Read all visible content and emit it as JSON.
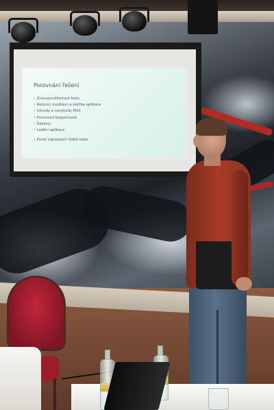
{
  "slide": {
    "title": "Porovnání řešení",
    "bullets": [
      "Znovupoužitelnost kódu",
      "Rodoucí rozdělení a údržba aplikace",
      "Výhody a nevýhody MVC",
      "Porovnání bezpečnosti",
      "Šablony",
      "Ladění aplikace"
    ],
    "extra": "Počet napsaných řádků kódu"
  }
}
